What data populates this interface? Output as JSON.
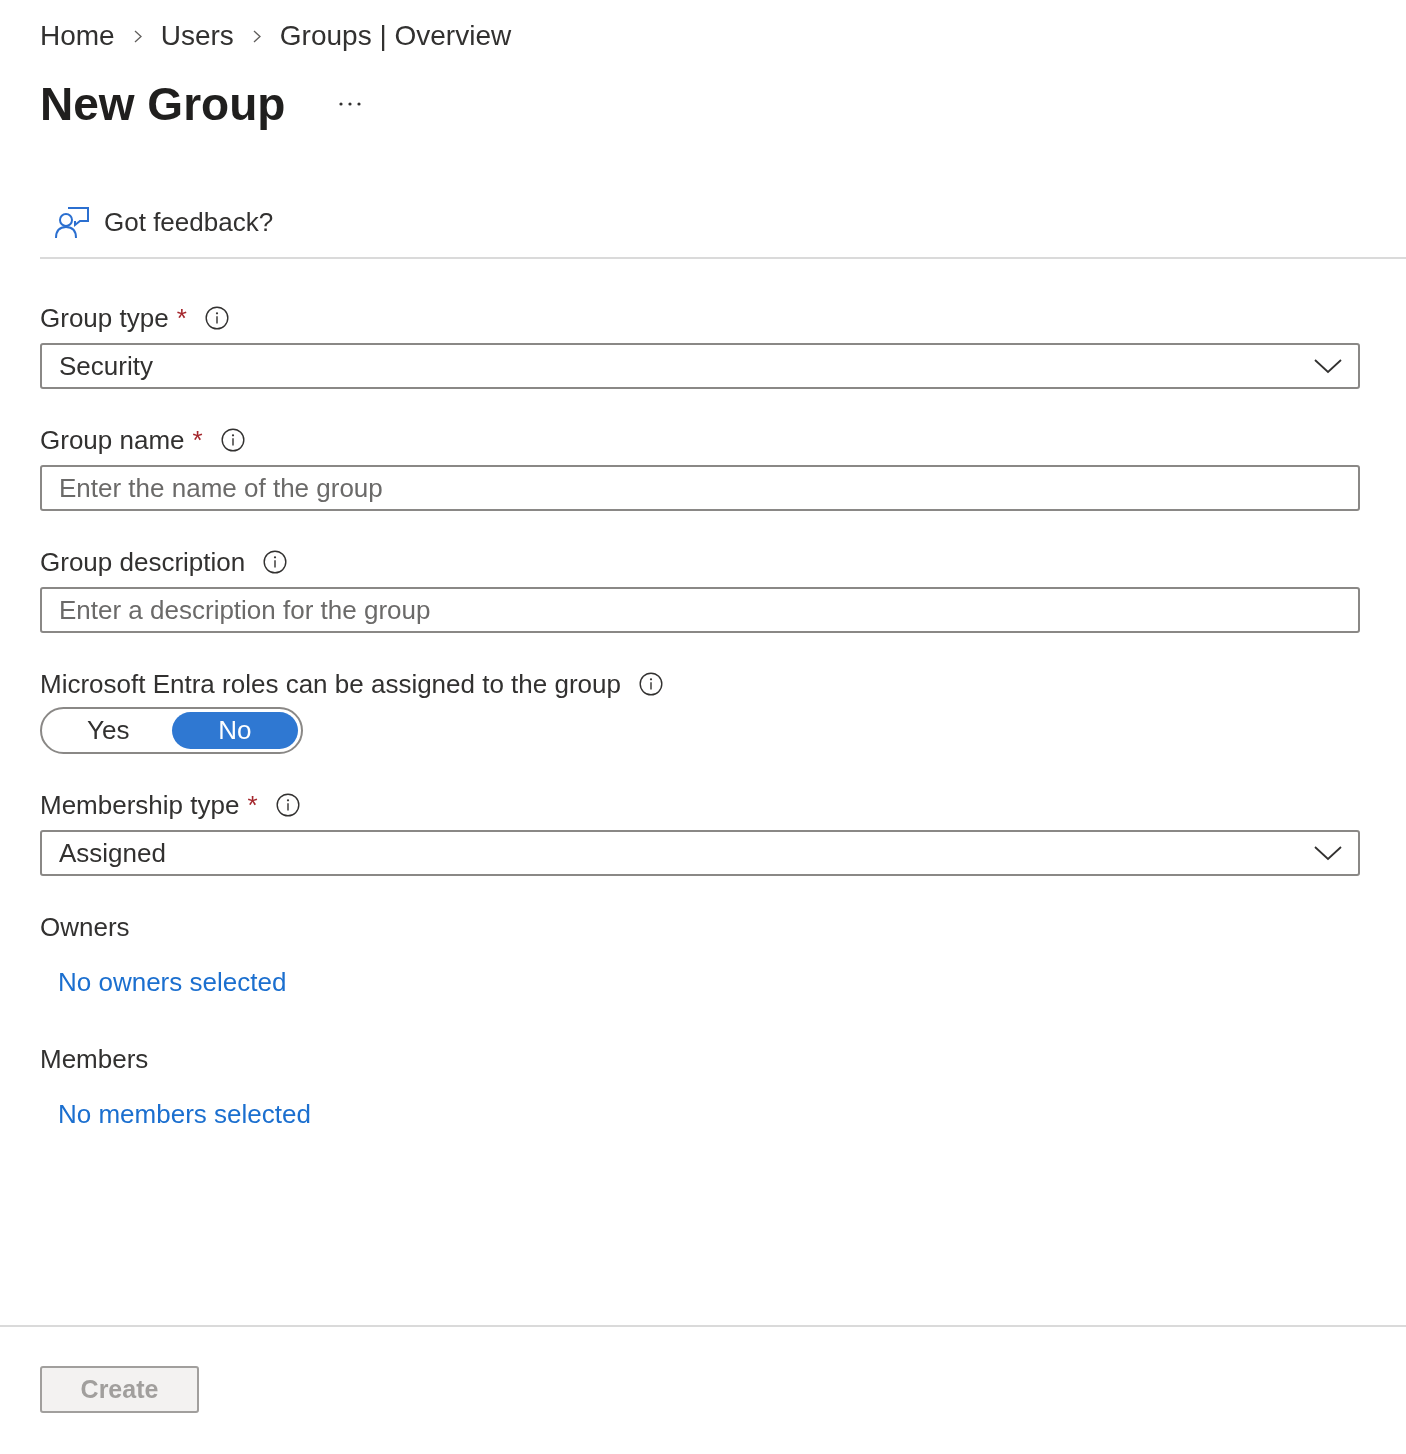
{
  "breadcrumb": [
    {
      "label": "Home"
    },
    {
      "label": "Users"
    },
    {
      "label": "Groups | Overview"
    }
  ],
  "page": {
    "title": "New Group"
  },
  "feedback": {
    "label": "Got feedback?"
  },
  "fields": [
    {
      "kind": "dropdown",
      "label": "Group type",
      "required_mark": "*",
      "info": true,
      "value": "Security"
    },
    {
      "kind": "text",
      "label": "Group name",
      "required_mark": "*",
      "info": true,
      "placeholder": "Enter the name of the group"
    },
    {
      "kind": "text",
      "label": "Group description",
      "info": true,
      "placeholder": "Enter a description for the group"
    },
    {
      "kind": "toggle",
      "label": "Microsoft Entra roles can be assigned to the group",
      "info": true,
      "options": [
        {
          "label": "Yes",
          "selected": false
        },
        {
          "label": "No",
          "selected": true
        }
      ]
    },
    {
      "kind": "dropdown",
      "label": "Membership type",
      "required_mark": "*",
      "info": true,
      "value": "Assigned"
    },
    {
      "kind": "picker",
      "label": "Owners",
      "info": false,
      "link": "No owners selected"
    },
    {
      "kind": "picker",
      "label": "Members",
      "info": false,
      "link": "No members selected"
    }
  ],
  "footer": {
    "buttons": [
      {
        "label": "Create",
        "disabled": true
      }
    ]
  }
}
